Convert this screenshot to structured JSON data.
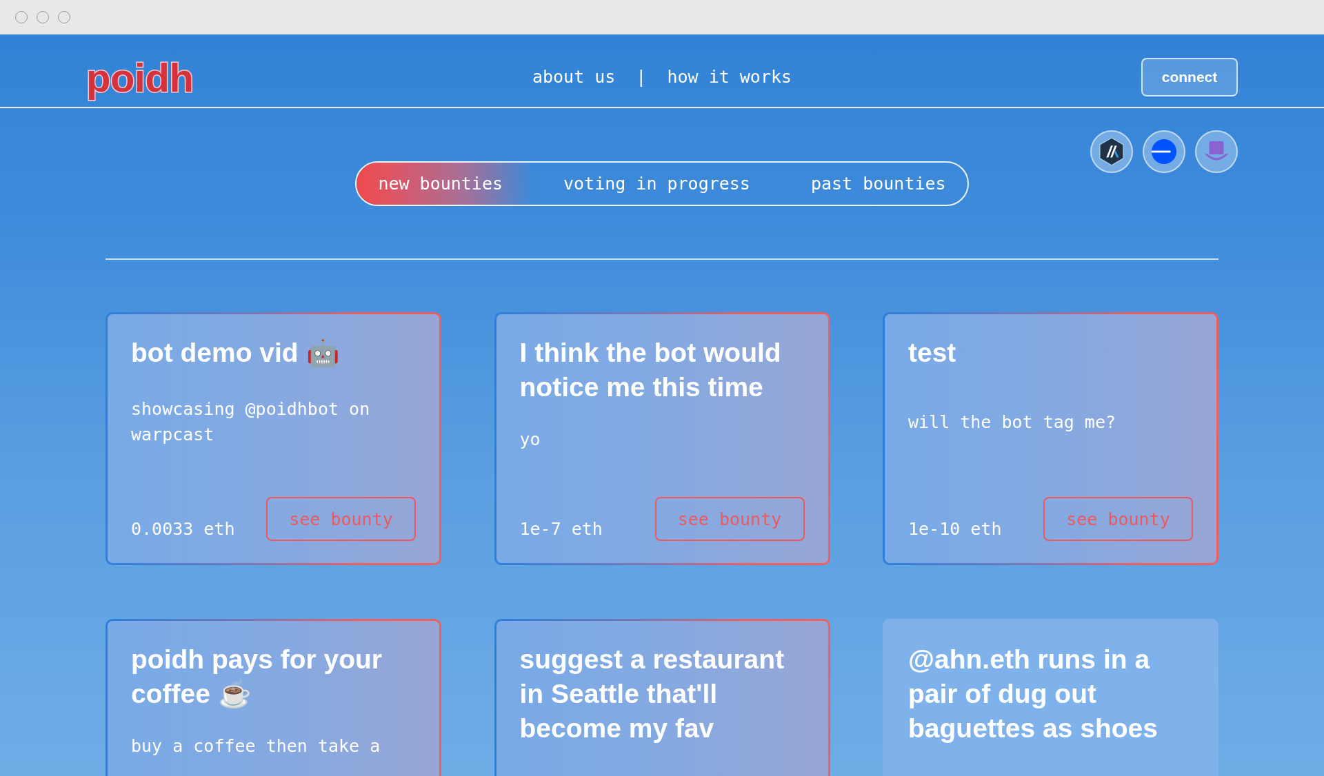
{
  "header": {
    "logo": "poidh",
    "nav": [
      {
        "label": "about us"
      },
      {
        "label": "how it works"
      }
    ],
    "separator": "|",
    "connect_button": "connect"
  },
  "tabs": [
    {
      "label": "new bounties",
      "selected": true
    },
    {
      "label": "voting in progress",
      "selected": false
    },
    {
      "label": "past bounties",
      "selected": false
    }
  ],
  "cards": [
    {
      "title": "bot demo vid 🤖",
      "description": "showcasing @poidhbot on warpcast",
      "amount": "0.0033 eth",
      "button": "see bounty",
      "highlighted": true
    },
    {
      "title": "I think the bot would notice me this time",
      "description": "yo",
      "amount": "1e-7 eth",
      "button": "see bounty",
      "highlighted": true
    },
    {
      "title": "test",
      "description": "will the bot tag me?",
      "amount": "1e-10 eth",
      "button": "see bounty",
      "highlighted": true
    },
    {
      "title": "poidh pays for your coffee ☕",
      "description": "buy a coffee then take a",
      "highlighted": true
    },
    {
      "title": "suggest a restaurant in Seattle that'll become my fav",
      "highlighted": true
    },
    {
      "title": "@ahn.eth runs in a pair of dug out baguettes as shoes",
      "highlighted": false
    }
  ]
}
